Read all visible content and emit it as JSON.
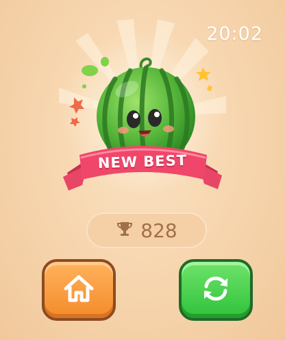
{
  "status": {
    "time": "20:02"
  },
  "result": {
    "banner_text": "NEW BEST",
    "best_score": "828"
  },
  "icons": {
    "mascot": "watermelon-mascot",
    "score": "trophy-icon",
    "home": "home-icon",
    "restart": "restart-icon"
  },
  "colors": {
    "background": "#f6d4ac",
    "banner": "#f0466a",
    "home_button": "#f48b2a",
    "restart_button": "#2fc23a",
    "score_text": "#a0704c"
  }
}
